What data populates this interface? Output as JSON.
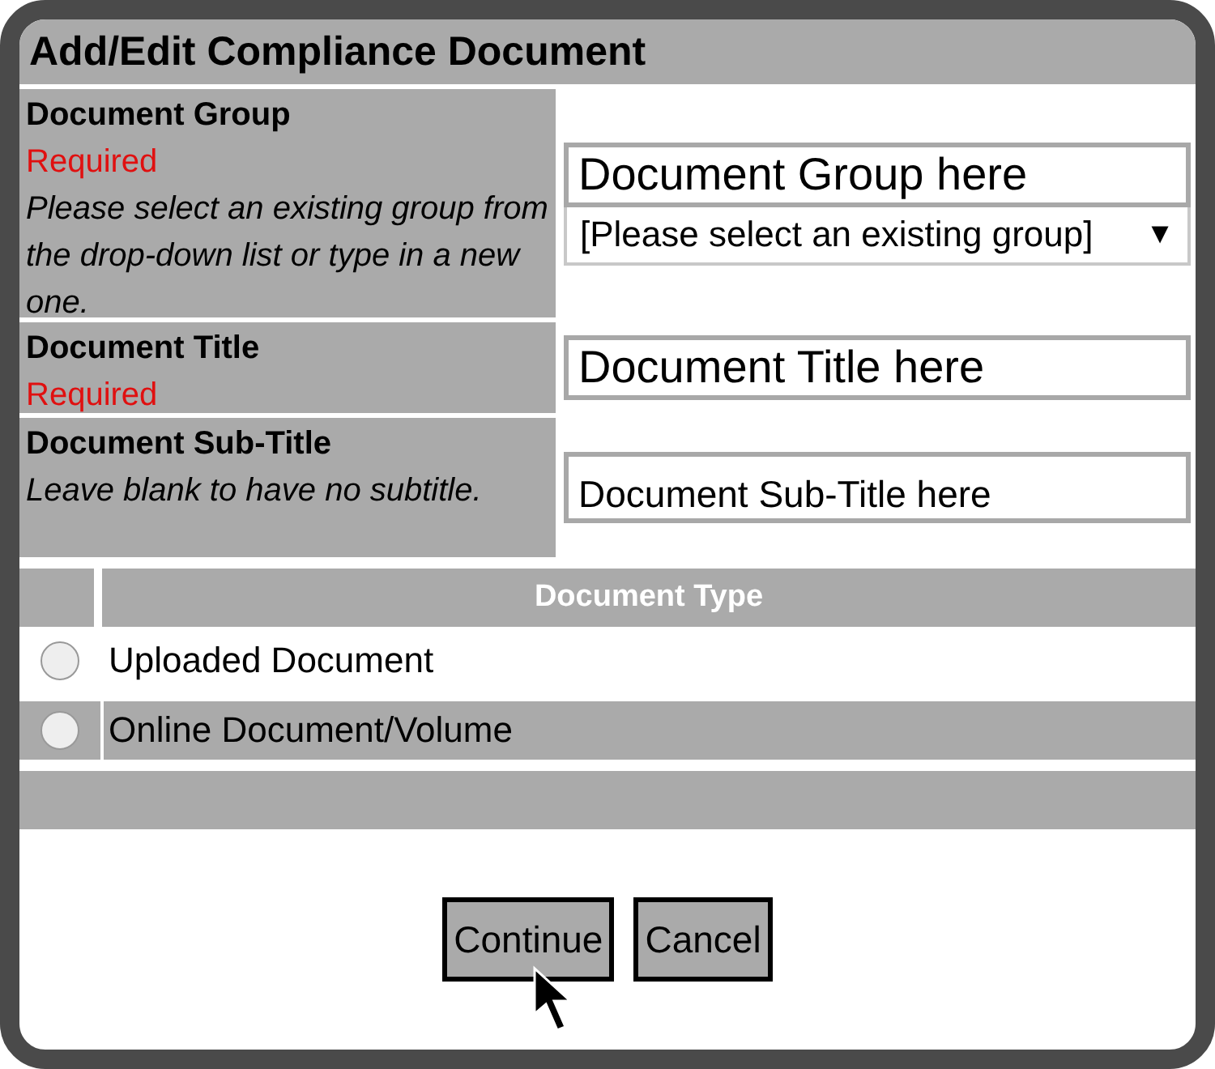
{
  "window": {
    "title": "Add/Edit Compliance Document"
  },
  "fields": [
    {
      "kind": "combo",
      "label": "Document Group",
      "required": "Required",
      "help": "Please select an existing group from the drop-down list or type in a new one.",
      "value": "Document Group here",
      "select": {
        "value": "[Please select an existing group]",
        "arrow": "▼"
      }
    },
    {
      "kind": "text",
      "label": "Document Title",
      "required": "Required",
      "value": "Document Title here"
    },
    {
      "kind": "small",
      "label": "Document Sub-Title",
      "help": "Leave blank to have no subtitle.",
      "value": "Document Sub-Title here"
    }
  ],
  "document_type": {
    "heading": "Document Type",
    "options": [
      {
        "label": "Uploaded Document",
        "selected": false
      },
      {
        "label": "Online Document/Volume",
        "selected": false
      }
    ]
  },
  "buttons": [
    "Continue",
    "Cancel"
  ]
}
